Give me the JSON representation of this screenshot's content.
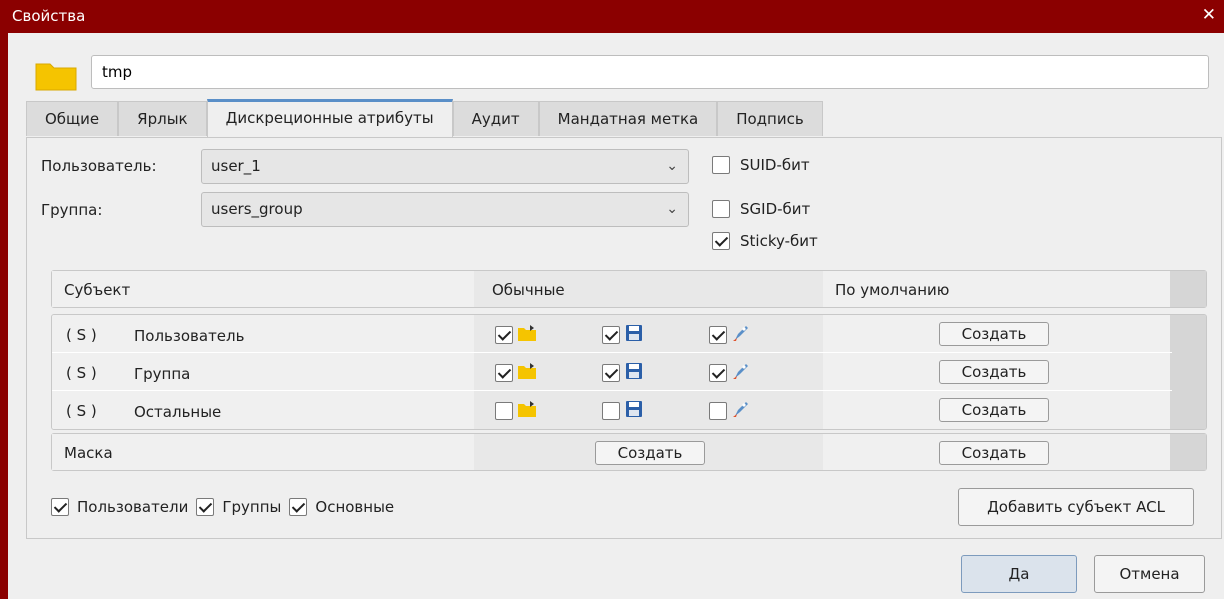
{
  "window": {
    "title": "Свойства",
    "close_glyph": "✕"
  },
  "file": {
    "name": "tmp",
    "icon": "folder-icon"
  },
  "tabs": [
    {
      "label": "Общие"
    },
    {
      "label": "Ярлык"
    },
    {
      "label": "Дискреционные атрибуты",
      "active": true
    },
    {
      "label": "Аудит"
    },
    {
      "label": "Мандатная метка"
    },
    {
      "label": "Подпись"
    }
  ],
  "owner": {
    "user_label": "Пользователь:",
    "user_value": "user_1",
    "group_label": "Группа:",
    "group_value": "users_group",
    "arrow": "⌄"
  },
  "special_bits": [
    {
      "label": "SUID-бит",
      "checked": false
    },
    {
      "label": "SGID-бит",
      "checked": false
    },
    {
      "label": "Sticky-бит",
      "checked": true
    }
  ],
  "acl_table": {
    "headers": {
      "subject": "Субъект",
      "regular": "Обычные",
      "default": "По умолчанию"
    },
    "rows": [
      {
        "tag": "( S )",
        "name": "Пользователь",
        "read": true,
        "write": true,
        "exec": true,
        "create": "Создать"
      },
      {
        "tag": "( S )",
        "name": "Группа",
        "read": true,
        "write": true,
        "exec": true,
        "create": "Создать"
      },
      {
        "tag": "( S )",
        "name": "Остальные",
        "read": false,
        "write": false,
        "exec": false,
        "create": "Создать"
      }
    ],
    "mask": {
      "label": "Маска",
      "create_regular": "Создать",
      "create_default": "Создать"
    }
  },
  "filters": [
    {
      "label": "Пользователи",
      "checked": true
    },
    {
      "label": "Группы",
      "checked": true
    },
    {
      "label": "Основные",
      "checked": true
    }
  ],
  "add_acl_button": "Добавить субъект ACL",
  "footer": {
    "ok": "Да",
    "cancel": "Отмена"
  },
  "colors": {
    "titlebar": "#8b0000",
    "accent": "#5a8fc8",
    "folder": "#f5c400"
  }
}
